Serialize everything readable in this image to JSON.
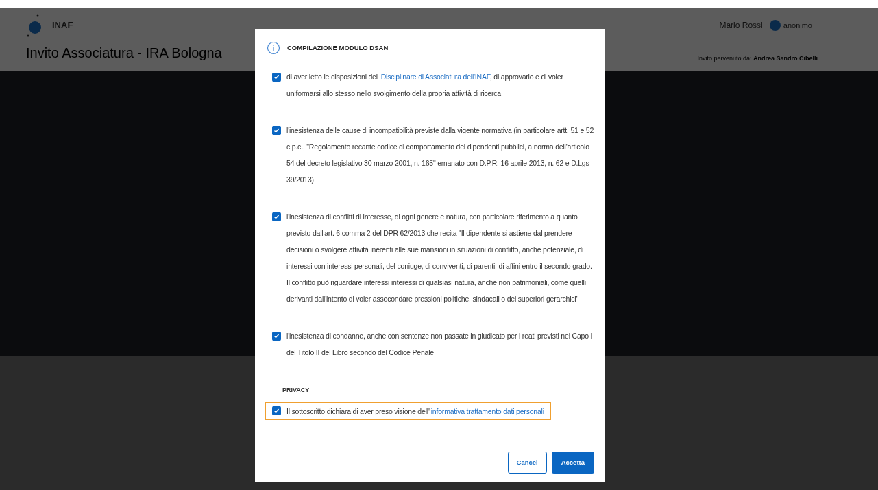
{
  "header": {
    "logo_text": "INAF",
    "page_title": "Invito Associatura - IRA Bologna",
    "user_name": "Mario Rossi",
    "user_badge": "anonimo",
    "invited_by": "Invito pervenuto da: **Andrea Sandro Cibelli**"
  },
  "modal": {
    "title": "COMPILAZIONE MODULO DSAN",
    "declarations": [
      {
        "checked": true,
        "before": "di aver letto le disposizioni del ",
        "link": "Disciplinare di Associatura dell'INAF",
        "after": ", di approvarlo e di voler uniformarsi allo stesso nello svolgimento della propria attività di ricerca"
      },
      {
        "checked": true,
        "before": "l'inesistenza delle cause di incompatibilità previste dalla vigente normativa (in particolare artt. 51 e 52 c.p.c., \"Regolamento recante codice di comportamento dei dipendenti pubblici, a norma dell'articolo 54 del decreto legislativo 30 marzo 2001, n. 165\" emanato con D.P.R. 16 aprile 2013, n. 62 e D.Lgs 39/2013)"
      },
      {
        "checked": true,
        "before": "l'inesistenza di conflitti di interesse, di ogni genere e natura, con particolare riferimento a quanto previsto dall'art. 6 comma 2 del DPR 62/2013 che recita \"Il dipendente si astiene dal prendere decisioni o svolgere attività inerenti alle sue mansioni in situazioni di conflitto, anche potenziale, di interessi con interessi personali, del coniuge, di conviventi, di parenti, di affini entro il secondo grado. Il conflitto può riguardare interessi interessi di qualsiasi natura, anche non patrimoniali, come quelli derivanti dall'intento di voler assecondare pressioni politiche, sindacali o dei superiori gerarchici\""
      },
      {
        "checked": true,
        "before": "l'inesistenza di condanne, anche con sentenze non passate in giudicato per i reati previsti nel Capo I del Titolo II del Libro secondo del Codice Penale"
      }
    ],
    "privacy_heading": "PRIVACY",
    "privacy": {
      "checked": true,
      "focused": true,
      "before": "Il sottoscritto dichiara di aver preso visione dell'",
      "link": "informativa trattamento dati personali"
    },
    "buttons": [
      {
        "label": "Cancel",
        "kind": "secondary"
      },
      {
        "label": "Accetta",
        "kind": "primary"
      }
    ]
  }
}
